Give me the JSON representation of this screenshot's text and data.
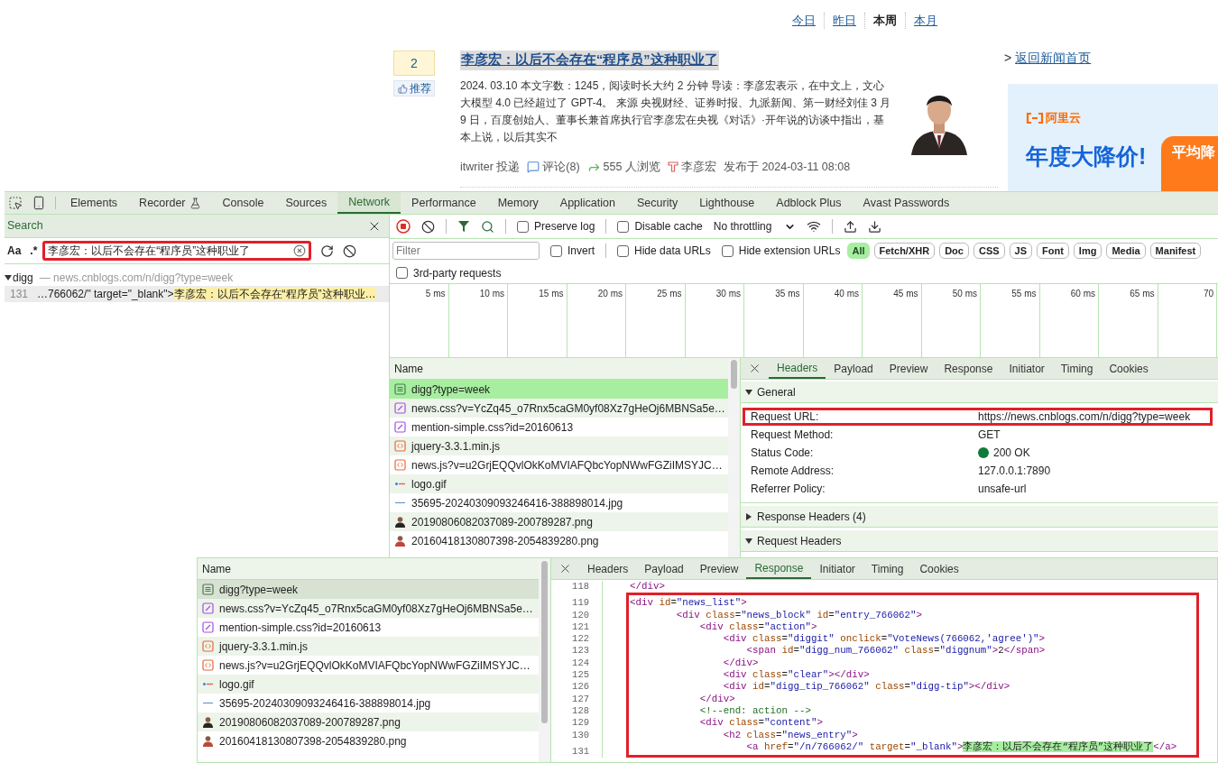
{
  "page": {
    "period_tabs": [
      {
        "label": "今日",
        "selected": false
      },
      {
        "label": "昨日",
        "selected": false
      },
      {
        "label": "本周",
        "selected": true
      },
      {
        "label": "本月",
        "selected": false
      }
    ],
    "news": {
      "digg_count": "2",
      "recommend": "推荐",
      "title": "李彦宏：以后不会存在“程序员”这种职业了",
      "summary": "2024. 03.10 本文字数：1245，阅读时长大约 2 分钟 导读：李彦宏表示，在中文上，文心大模型 4.0 已经超过了 GPT-4。 来源 央视财经、证券时报、九派新闻、第一财经刘佳 3 月 9 日，百度创始人、董事长兼首席执行官李彦宏在央视《对话》·开年说的访谈中指出，基本上说，以后其实不",
      "submitter": "itwriter 投递",
      "comments": "评论(8)",
      "views": "555 人浏览",
      "author": "李彦宏",
      "published": "发布于 2024-03-11 08:08"
    },
    "sidebar_link_prefix": ">",
    "sidebar_link": "返回新闻首页",
    "ad": {
      "brand": "阿里云",
      "headline": "年度大降价!",
      "badge": "平均降"
    }
  },
  "devtools": {
    "tabs": [
      {
        "label": "Elements",
        "kind": "plain",
        "selected": false
      },
      {
        "label": "Recorder",
        "kind": "experimental",
        "selected": false
      },
      {
        "label": "Console",
        "kind": "plain",
        "selected": false
      },
      {
        "label": "Sources",
        "kind": "plain",
        "selected": false
      },
      {
        "label": "Network",
        "kind": "plain",
        "selected": true
      },
      {
        "label": "Performance",
        "kind": "plain",
        "selected": false
      },
      {
        "label": "Memory",
        "kind": "plain",
        "selected": false
      },
      {
        "label": "Application",
        "kind": "plain",
        "selected": false
      },
      {
        "label": "Security",
        "kind": "plain",
        "selected": false
      },
      {
        "label": "Lighthouse",
        "kind": "plain",
        "selected": false
      },
      {
        "label": "Adblock Plus",
        "kind": "plain",
        "selected": false
      },
      {
        "label": "Avast Passwords",
        "kind": "plain",
        "selected": false
      }
    ],
    "search": {
      "title": "Search",
      "case_label": "Aa",
      "regex_label": ".*",
      "query": "李彦宏：以后不会存在“程序员”这种职业了",
      "annotated": true,
      "results": [
        {
          "file": "digg",
          "separator": "—",
          "url": "news.cnblogs.com/n/digg?type=week",
          "expanded": true,
          "children": [
            {
              "line": "131",
              "before": "…766062/\" target=\"_blank\">",
              "match": "李彦宏：以后不会存在“程序员”这种职业…"
            }
          ]
        }
      ]
    },
    "network": {
      "preserve_log": {
        "label": "Preserve log",
        "checked": false
      },
      "disable_cache": {
        "label": "Disable cache",
        "checked": false
      },
      "throttling": "No throttling",
      "filter": {
        "placeholder": "Filter",
        "invert": {
          "label": "Invert",
          "checked": false
        },
        "hide_data_urls": {
          "label": "Hide data URLs",
          "checked": false
        },
        "hide_extension_urls": {
          "label": "Hide extension URLs",
          "checked": false
        },
        "types": [
          {
            "label": "All",
            "selected": true
          },
          {
            "label": "Fetch/XHR",
            "selected": false
          },
          {
            "label": "Doc",
            "selected": false
          },
          {
            "label": "CSS",
            "selected": false
          },
          {
            "label": "JS",
            "selected": false
          },
          {
            "label": "Font",
            "selected": false
          },
          {
            "label": "Img",
            "selected": false
          },
          {
            "label": "Media",
            "selected": false
          },
          {
            "label": "Manifest",
            "selected": false
          }
        ]
      },
      "third_party": {
        "label": "3rd-party requests",
        "checked": false
      },
      "timeline_ticks": [
        "5 ms",
        "10 ms",
        "15 ms",
        "20 ms",
        "25 ms",
        "30 ms",
        "35 ms",
        "40 ms",
        "45 ms",
        "50 ms",
        "55 ms",
        "60 ms",
        "65 ms",
        "70"
      ],
      "requests": {
        "name_header": "Name",
        "focused": true,
        "rows": [
          {
            "name": "digg?type=week",
            "kind": "document",
            "selected": true
          },
          {
            "name": "news.css?v=YcZq45_o7Rnx5caGM0yf08Xz7gHeOj6MBNSa5e…",
            "kind": "stylesheet",
            "selected": false
          },
          {
            "name": "mention-simple.css?id=20160613",
            "kind": "stylesheet",
            "selected": false
          },
          {
            "name": "jquery-3.3.1.min.js",
            "kind": "script",
            "selected": false
          },
          {
            "name": "news.js?v=u2GrjEQQvlOkKoMVIAFQbcYopNWwFGZiIMSYJC…",
            "kind": "script",
            "selected": false
          },
          {
            "name": "logo.gif",
            "kind": "gif",
            "selected": false
          },
          {
            "name": "35695-20240309093246416-388898014.jpg",
            "kind": "line",
            "selected": false
          },
          {
            "name": "20190806082037089-200789287.png",
            "kind": "avatar",
            "selected": false
          },
          {
            "name": "20160418130807398-2054839280.png",
            "kind": "avatar2",
            "selected": false
          }
        ]
      },
      "details": {
        "tabs": [
          {
            "label": "Headers",
            "selected": true
          },
          {
            "label": "Payload",
            "selected": false
          },
          {
            "label": "Preview",
            "selected": false
          },
          {
            "label": "Response",
            "selected": false
          },
          {
            "label": "Initiator",
            "selected": false
          },
          {
            "label": "Timing",
            "selected": false
          },
          {
            "label": "Cookies",
            "selected": false
          }
        ],
        "general": {
          "title": "General",
          "expanded": true,
          "rows": [
            {
              "label": "Request URL:",
              "value": "https://news.cnblogs.com/n/digg?type=week",
              "kind": "text",
              "annotated": true
            },
            {
              "label": "Request Method:",
              "value": "GET",
              "kind": "text",
              "annotated": false
            },
            {
              "label": "Status Code:",
              "value": "200 OK",
              "kind": "status",
              "annotated": false
            },
            {
              "label": "Remote Address:",
              "value": "127.0.0.1:7890",
              "kind": "text",
              "annotated": false
            },
            {
              "label": "Referrer Policy:",
              "value": "unsafe-url",
              "kind": "text",
              "annotated": false
            }
          ]
        },
        "response_headers": {
          "title": "Response Headers (4)",
          "expanded": false
        },
        "request_headers": {
          "title": "Request Headers",
          "expanded": true
        }
      }
    }
  },
  "overlay": {
    "requests": {
      "name_header": "Name",
      "focused": false,
      "rows": [
        {
          "name": "digg?type=week",
          "kind": "document",
          "selected": true
        },
        {
          "name": "news.css?v=YcZq45_o7Rnx5caGM0yf08Xz7gHeOj6MBNSa5e…",
          "kind": "stylesheet",
          "selected": false
        },
        {
          "name": "mention-simple.css?id=20160613",
          "kind": "stylesheet",
          "selected": false
        },
        {
          "name": "jquery-3.3.1.min.js",
          "kind": "script",
          "selected": false
        },
        {
          "name": "news.js?v=u2GrjEQQvlOkKoMVIAFQbcYopNWwFGZiIMSYJC…",
          "kind": "script",
          "selected": false
        },
        {
          "name": "logo.gif",
          "kind": "gif",
          "selected": false
        },
        {
          "name": "35695-20240309093246416-388898014.jpg",
          "kind": "line",
          "selected": false
        },
        {
          "name": "20190806082037089-200789287.png",
          "kind": "avatar",
          "selected": false
        },
        {
          "name": "20160418130807398-2054839280.png",
          "kind": "avatar2",
          "selected": false
        }
      ]
    },
    "details": {
      "tabs": [
        {
          "label": "Headers",
          "selected": false
        },
        {
          "label": "Payload",
          "selected": false
        },
        {
          "label": "Preview",
          "selected": false
        },
        {
          "label": "Response",
          "selected": true
        },
        {
          "label": "Initiator",
          "selected": false
        },
        {
          "label": "Timing",
          "selected": false
        },
        {
          "label": "Cookies",
          "selected": false
        }
      ],
      "code": {
        "lines": [
          {
            "number": "118",
            "framed": false,
            "tokens": [
              {
                "kind": "tag",
                "text": "</div>"
              }
            ]
          },
          {
            "number": "119",
            "framed": true,
            "tokens": [
              {
                "kind": "tag",
                "text": "<div"
              },
              {
                "kind": "attr",
                "text": " id"
              },
              {
                "kind": "plain",
                "text": "="
              },
              {
                "kind": "value",
                "text": "\"news_list\""
              },
              {
                "kind": "tag",
                "text": ">"
              }
            ]
          },
          {
            "number": "120",
            "framed": true,
            "tokens": [
              {
                "kind": "tag",
                "text": "        <div"
              },
              {
                "kind": "attr",
                "text": " class"
              },
              {
                "kind": "plain",
                "text": "="
              },
              {
                "kind": "value",
                "text": "\"news_block\""
              },
              {
                "kind": "attr",
                "text": " id"
              },
              {
                "kind": "plain",
                "text": "="
              },
              {
                "kind": "value",
                "text": "\"entry_766062\""
              },
              {
                "kind": "tag",
                "text": ">"
              }
            ]
          },
          {
            "number": "121",
            "framed": true,
            "tokens": [
              {
                "kind": "tag",
                "text": "            <div"
              },
              {
                "kind": "attr",
                "text": " class"
              },
              {
                "kind": "plain",
                "text": "="
              },
              {
                "kind": "value",
                "text": "\"action\""
              },
              {
                "kind": "tag",
                "text": ">"
              }
            ]
          },
          {
            "number": "122",
            "framed": true,
            "tokens": [
              {
                "kind": "tag",
                "text": "                <div"
              },
              {
                "kind": "attr",
                "text": " class"
              },
              {
                "kind": "plain",
                "text": "="
              },
              {
                "kind": "value",
                "text": "\"diggit\""
              },
              {
                "kind": "attr",
                "text": " onclick"
              },
              {
                "kind": "plain",
                "text": "="
              },
              {
                "kind": "value",
                "text": "\"VoteNews(766062,'agree')\""
              },
              {
                "kind": "tag",
                "text": ">"
              }
            ]
          },
          {
            "number": "123",
            "framed": true,
            "tokens": [
              {
                "kind": "tag",
                "text": "                    <span"
              },
              {
                "kind": "attr",
                "text": " id"
              },
              {
                "kind": "plain",
                "text": "="
              },
              {
                "kind": "value",
                "text": "\"digg_num_766062\""
              },
              {
                "kind": "attr",
                "text": " class"
              },
              {
                "kind": "plain",
                "text": "="
              },
              {
                "kind": "value",
                "text": "\"diggnum\""
              },
              {
                "kind": "tag",
                "text": ">"
              },
              {
                "kind": "plain",
                "text": "2"
              },
              {
                "kind": "tag",
                "text": "</span>"
              }
            ]
          },
          {
            "number": "124",
            "framed": true,
            "tokens": [
              {
                "kind": "tag",
                "text": "                </div>"
              }
            ]
          },
          {
            "number": "125",
            "framed": true,
            "tokens": [
              {
                "kind": "tag",
                "text": "                <div"
              },
              {
                "kind": "attr",
                "text": " class"
              },
              {
                "kind": "plain",
                "text": "="
              },
              {
                "kind": "value",
                "text": "\"clear\""
              },
              {
                "kind": "tag",
                "text": "></div>"
              }
            ]
          },
          {
            "number": "126",
            "framed": true,
            "tokens": [
              {
                "kind": "tag",
                "text": "                <div"
              },
              {
                "kind": "attr",
                "text": " id"
              },
              {
                "kind": "plain",
                "text": "="
              },
              {
                "kind": "value",
                "text": "\"digg_tip_766062\""
              },
              {
                "kind": "attr",
                "text": " class"
              },
              {
                "kind": "plain",
                "text": "="
              },
              {
                "kind": "value",
                "text": "\"digg-tip\""
              },
              {
                "kind": "tag",
                "text": "></div>"
              }
            ]
          },
          {
            "number": "127",
            "framed": true,
            "tokens": [
              {
                "kind": "tag",
                "text": "            </div>"
              }
            ]
          },
          {
            "number": "128",
            "framed": true,
            "tokens": [
              {
                "kind": "comment",
                "text": "            <!--end: action -->"
              }
            ]
          },
          {
            "number": "129",
            "framed": true,
            "tokens": [
              {
                "kind": "tag",
                "text": "            <div"
              },
              {
                "kind": "attr",
                "text": " class"
              },
              {
                "kind": "plain",
                "text": "="
              },
              {
                "kind": "value",
                "text": "\"content\""
              },
              {
                "kind": "tag",
                "text": ">"
              }
            ]
          },
          {
            "number": "130",
            "framed": true,
            "tokens": [
              {
                "kind": "tag",
                "text": "                <h2"
              },
              {
                "kind": "attr",
                "text": " class"
              },
              {
                "kind": "plain",
                "text": "="
              },
              {
                "kind": "value",
                "text": "\"news_entry\""
              },
              {
                "kind": "tag",
                "text": ">"
              }
            ]
          },
          {
            "number": "131",
            "framed": true,
            "tokens": [
              {
                "kind": "tag",
                "text": "                    <a"
              },
              {
                "kind": "attr",
                "text": " href"
              },
              {
                "kind": "plain",
                "text": "="
              },
              {
                "kind": "value",
                "text": "\"/n/766062/\""
              },
              {
                "kind": "attr",
                "text": " target"
              },
              {
                "kind": "plain",
                "text": "="
              },
              {
                "kind": "value",
                "text": "\"_blank\""
              },
              {
                "kind": "tag",
                "text": ">"
              },
              {
                "kind": "match",
                "text": "李彦宏：以后不会存在“程序员”这种职业了"
              },
              {
                "kind": "tag",
                "text": "</a>"
              }
            ]
          }
        ]
      }
    }
  }
}
